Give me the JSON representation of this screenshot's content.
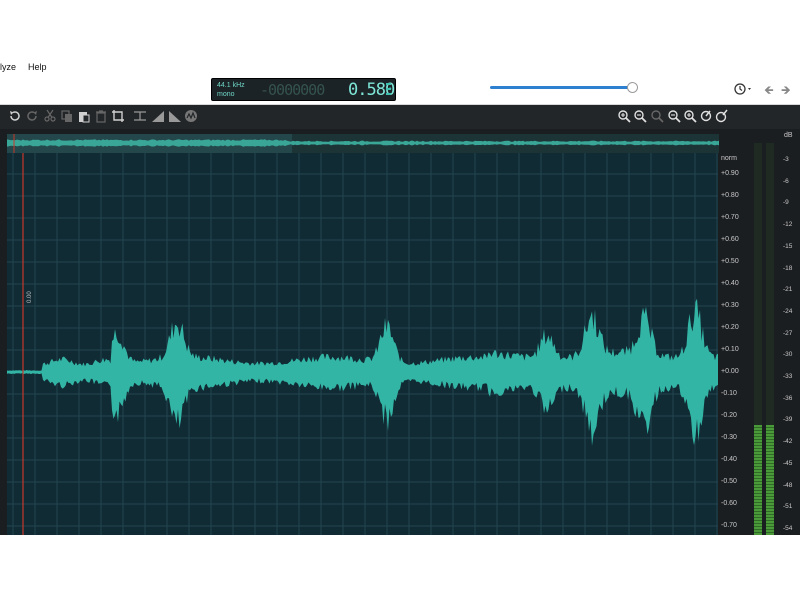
{
  "menu": {
    "items": [
      "lyze",
      "Help"
    ]
  },
  "display": {
    "rate": "44.1 kHz",
    "channels": "mono",
    "value_dots": "-0000000",
    "value": "0.580"
  },
  "playback_slider": {
    "position": 0.97
  },
  "editor": {
    "amplitude_scale": {
      "unit": "norm",
      "ticks": [
        "+0.90",
        "+0.80",
        "+0.70",
        "+0.60",
        "+0.50",
        "+0.40",
        "+0.30",
        "+0.20",
        "+0.10",
        "+0.00",
        "-0.10",
        "-0.20",
        "-0.30",
        "-0.40",
        "-0.50",
        "-0.60",
        "-0.70"
      ]
    },
    "meter_scale": {
      "unit": "dB",
      "ticks": [
        "-3",
        "-6",
        "-9",
        "-12",
        "-15",
        "-18",
        "-21",
        "-24",
        "-27",
        "-30",
        "-33",
        "-36",
        "-39",
        "-42",
        "-45",
        "-48",
        "-51",
        "-54"
      ]
    },
    "playhead_label": "0.00",
    "meter_level": 0.28,
    "toolbar_left": [
      "undo-icon",
      "redo-icon",
      "cut-icon",
      "copy-icon",
      "paste-icon",
      "delete-icon",
      "crop-icon",
      "silence-icon",
      "fade-in-icon",
      "fade-out-icon",
      "spectrum-icon"
    ],
    "toolbar_right": [
      "zoom-in-icon",
      "zoom-out-icon",
      "zoom-selection-icon",
      "zoom-out-full-icon",
      "zoom-in-amplitude-icon",
      "zoom-out-amplitude-icon",
      "zoom-reset-icon"
    ]
  },
  "colors": {
    "waveform": "#33b5a5",
    "background": "#112b35",
    "grid": "#224550",
    "playhead": "#c8382b",
    "meter": "#4a9a3a"
  }
}
